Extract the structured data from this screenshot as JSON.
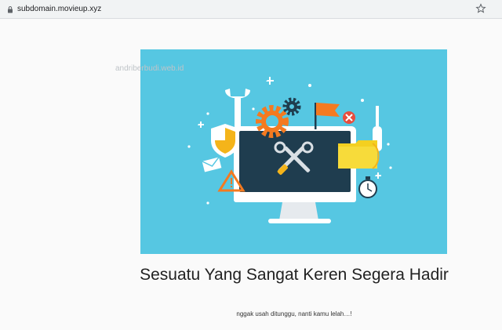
{
  "browser": {
    "url": "subdomain.movieup.xyz"
  },
  "watermark": "andriberbudi.web.id",
  "content": {
    "title": "Sesuatu Yang Sangat Keren Segera Hadir",
    "subtitle": "nggak usah ditunggu, nanti kamu lelah…!"
  },
  "colors": {
    "hero_background": "#56c7e2",
    "monitor_frame": "#ffffff",
    "monitor_screen": "#1f3d4f",
    "gear_orange": "#f47a20",
    "gear_navy": "#1f3d4f",
    "flag_orange": "#f47a20",
    "close_red": "#e84c3d",
    "shield_yellow": "#f4b41a",
    "folder_yellow": "#f4d020"
  },
  "icons": [
    "lock-icon",
    "bookmark-star-icon",
    "wrench-icon",
    "gear-icon",
    "flag-icon",
    "close-icon",
    "screwdriver-icon",
    "shield-icon",
    "envelope-icon",
    "warning-icon",
    "folder-icon",
    "clock-icon",
    "tools-icon",
    "monitor-icon"
  ]
}
